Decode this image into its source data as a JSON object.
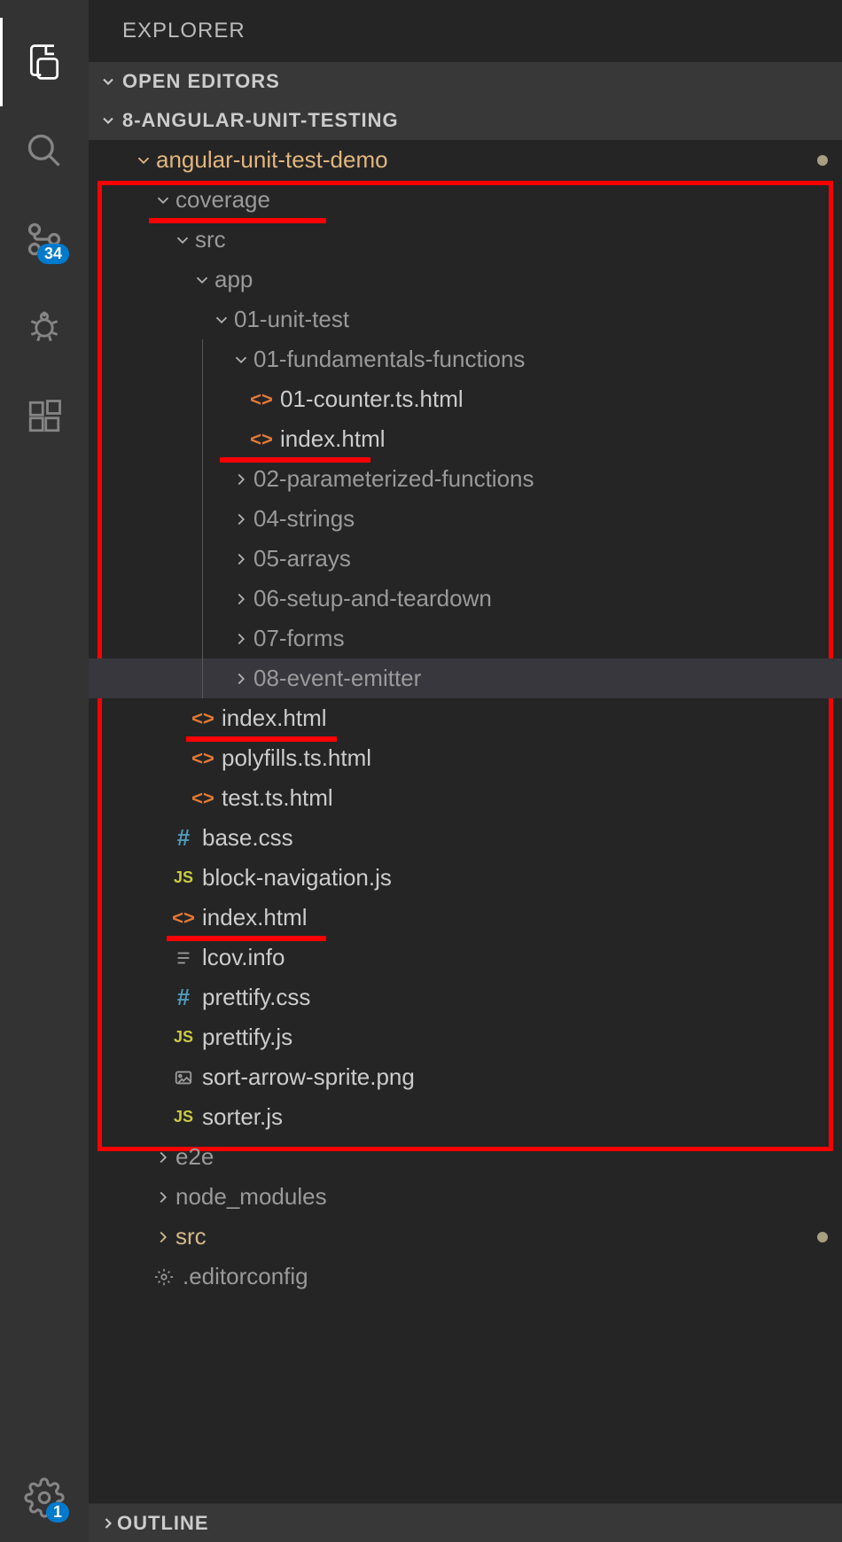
{
  "sidebar_title": "EXPLORER",
  "sections": {
    "open_editors": "OPEN EDITORS",
    "project": "8-ANGULAR-UNIT-TESTING",
    "outline": "OUTLINE"
  },
  "activity": {
    "scm_badge": "34",
    "settings_badge": "1"
  },
  "tree": {
    "root": "angular-unit-test-demo",
    "coverage": "coverage",
    "src": "src",
    "app": "app",
    "unit_test": "01-unit-test",
    "fundamentals": "01-fundamentals-functions",
    "counter": "01-counter.ts.html",
    "index1": "index.html",
    "parameterized": "02-parameterized-functions",
    "strings": "04-strings",
    "arrays": "05-arrays",
    "setup": "06-setup-and-teardown",
    "forms": "07-forms",
    "event_emitter": "08-event-emitter",
    "index2": "index.html",
    "polyfills": "polyfills.ts.html",
    "test_ts": "test.ts.html",
    "base_css": "base.css",
    "block_nav": "block-navigation.js",
    "index3": "index.html",
    "lcov": "lcov.info",
    "prettify_css": "prettify.css",
    "prettify_js": "prettify.js",
    "sprite": "sort-arrow-sprite.png",
    "sorter": "sorter.js",
    "e2e": "e2e",
    "node_modules": "node_modules",
    "src2": "src",
    "editorconfig": ".editorconfig"
  }
}
